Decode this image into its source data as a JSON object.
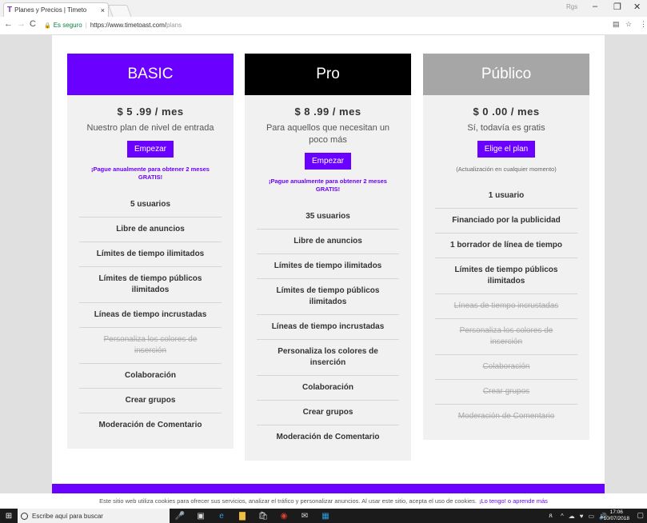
{
  "browser": {
    "tab_title": "Planes y Precios | Timeto",
    "tab_close": "×",
    "user": "Rgs",
    "secure_label": "Es seguro",
    "url": "https://www.timetoast.com/",
    "url_path": "plans"
  },
  "plans": [
    {
      "name": "BASIC",
      "header_color": "#6a00ff",
      "price": "$ 5 .99 / mes",
      "description": "Nuestro plan de nivel de entrada",
      "button": "Empezar",
      "extra": "¡Pague anualmente para obtener 2 meses GRATIS!",
      "features": [
        {
          "label": "5 usuarios",
          "included": true
        },
        {
          "label": "Libre de anuncios",
          "included": true
        },
        {
          "label": "Límites de tiempo ilimitados",
          "included": true
        },
        {
          "label": "Límites de tiempo públicos ilimitados",
          "included": true
        },
        {
          "label": "Líneas de tiempo incrustadas",
          "included": true
        },
        {
          "label": "Personaliza los colores de inserción",
          "included": false
        },
        {
          "label": "Colaboración",
          "included": true
        },
        {
          "label": "Crear grupos",
          "included": true
        },
        {
          "label": "Moderación de Comentario",
          "included": true
        }
      ]
    },
    {
      "name": "Pro",
      "header_color": "#000000",
      "price": "$ 8 .99 / mes",
      "description": "Para aquellos que necesitan un poco más",
      "button": "Empezar",
      "extra": "¡Pague anualmente para obtener 2 meses GRATIS!",
      "features": [
        {
          "label": "35 usuarios",
          "included": true
        },
        {
          "label": "Libre de anuncios",
          "included": true
        },
        {
          "label": "Límites de tiempo ilimitados",
          "included": true
        },
        {
          "label": "Límites de tiempo públicos ilimitados",
          "included": true
        },
        {
          "label": "Líneas de tiempo incrustadas",
          "included": true
        },
        {
          "label": "Personaliza los colores de inserción",
          "included": true
        },
        {
          "label": "Colaboración",
          "included": true
        },
        {
          "label": "Crear grupos",
          "included": true
        },
        {
          "label": "Moderación de Comentario",
          "included": true
        }
      ]
    },
    {
      "name": "Público",
      "header_color": "#a6a6a6",
      "price": "$ 0 .00 / mes",
      "description": "Sí, todavía es gratis",
      "button": "Elige el plan",
      "extra": "(Actualización en cualquier momento)",
      "features": [
        {
          "label": "1 usuario",
          "included": true
        },
        {
          "label": "Financiado por la publicidad",
          "included": true
        },
        {
          "label": "1 borrador de línea de tiempo",
          "included": true
        },
        {
          "label": "Límites de tiempo públicos ilimitados",
          "included": true
        },
        {
          "label": "Líneas de tiempo incrustadas",
          "included": false
        },
        {
          "label": "Personaliza los colores de inserción",
          "included": false
        },
        {
          "label": "Colaboración",
          "included": false
        },
        {
          "label": "Crear grupos",
          "included": false
        },
        {
          "label": "Moderación de Comentario",
          "included": false
        }
      ]
    }
  ],
  "cookie": {
    "text": "Este sitio web utiliza cookies para ofrecer sus servicios, analizar el tráfico y personalizar anuncios. Al usar este sitio, acepta el uso de cookies.",
    "link": "¡Lo tengo! o aprende más"
  },
  "taskbar": {
    "search_placeholder": "Escribe aquí para buscar",
    "time": "17:06",
    "date": "10/07/2018"
  },
  "colors": {
    "accent": "#6a00ff"
  }
}
